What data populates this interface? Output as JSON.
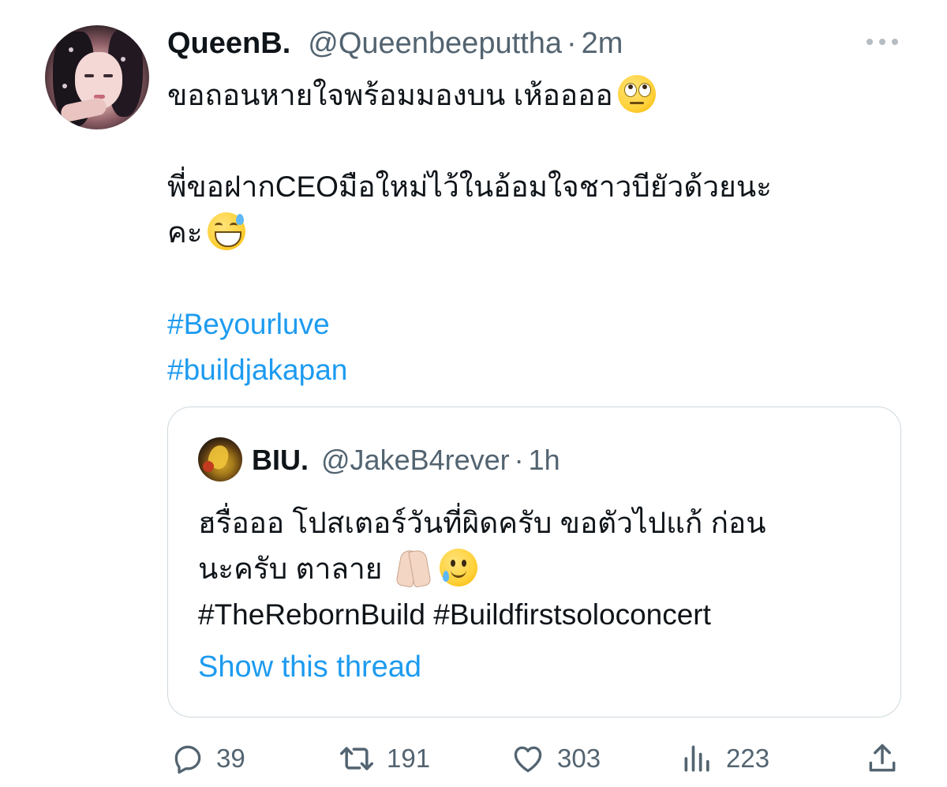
{
  "tweet": {
    "author": {
      "display_name": "QueenB.",
      "handle": "@Queenbeeputtha",
      "separator": "·",
      "time": "2m"
    },
    "text_lines": [
      "ขอถอนหายใจพร้อมมองบน เห้ออออ",
      "",
      "พี่ขอฝากCEOมือใหม่ไว้ในอ้อมใจชาวบียัวด้วยนะ",
      "คะ"
    ],
    "hashtags": [
      "#Beyourluve",
      "#buildjakapan"
    ]
  },
  "quoted_tweet": {
    "author": {
      "display_name": "BIU.",
      "handle": "@JakeB4rever",
      "separator": "·",
      "time": "1h"
    },
    "text_lines": [
      "ฮรื่อออ โปสเตอร์วันที่ผิดครับ ขอตัวไปแก้ ก่อน",
      "นะครับ ตาลาย"
    ],
    "hashtags": [
      "#TheRebornBuild",
      "#Buildfirstsoloconcert"
    ],
    "show_thread_label": "Show this thread"
  },
  "actions": {
    "reply": {
      "icon": "reply-icon",
      "count": "39"
    },
    "retweet": {
      "icon": "retweet-icon",
      "count": "191"
    },
    "like": {
      "icon": "heart-icon",
      "count": "303"
    },
    "views": {
      "icon": "views-icon",
      "count": "223"
    },
    "share": {
      "icon": "share-icon"
    }
  },
  "colors": {
    "text": "#0f1419",
    "secondary": "#536471",
    "link": "#1d9bf0",
    "border": "#cfd9de"
  }
}
